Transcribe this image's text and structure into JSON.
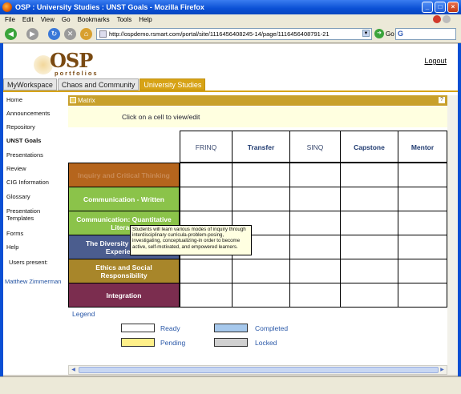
{
  "window": {
    "title": "OSP : University Studies : UNST Goals - Mozilla Firefox",
    "minimize": "_",
    "maximize": "□",
    "close": "×"
  },
  "menubar": [
    "File",
    "Edit",
    "View",
    "Go",
    "Bookmarks",
    "Tools",
    "Help"
  ],
  "navbar": {
    "back": "◀",
    "forward": "▶",
    "reload": "↻",
    "stop": "✕",
    "home": "⌂",
    "url": "http://ospdemo.rsmart.com/portal/site/1116456408245-14/page/1116456408791-21",
    "go_label": "Go",
    "search_value": "G"
  },
  "header": {
    "logo_text": "OSP",
    "logo_sub": "portfolios",
    "logout": "Logout"
  },
  "tabs": [
    {
      "label": "MyWorkspace",
      "active": false
    },
    {
      "label": "Chaos and Community",
      "active": false
    },
    {
      "label": "University Studies",
      "active": true
    }
  ],
  "sidebar": {
    "items": [
      {
        "label": "Home",
        "bold": false
      },
      {
        "label": "Announcements",
        "bold": false
      },
      {
        "label": "Repository",
        "bold": false
      },
      {
        "label": "UNST Goals",
        "bold": true
      },
      {
        "label": "Presentations",
        "bold": false
      },
      {
        "label": "Review",
        "bold": false
      },
      {
        "label": "CIG Information",
        "bold": false
      },
      {
        "label": "Glossary",
        "bold": false
      },
      {
        "label": "Presentation Templates",
        "bold": false
      },
      {
        "label": "Forms",
        "bold": false
      },
      {
        "label": "Help",
        "bold": false
      }
    ],
    "users_present_label": "Users present:",
    "user": "Matthew Zimmerman"
  },
  "matrix": {
    "title": "Matrix",
    "help": "?",
    "instruction": "Click on a cell to view/edit",
    "columns": [
      "FRINQ",
      "Transfer",
      "SINQ",
      "Capstone",
      "Mentor"
    ],
    "rows": [
      {
        "label": "Inquiry and Critical Thinking",
        "color": "#b5651d",
        "text_color": "#c98a55"
      },
      {
        "label": "Communication - Written",
        "color": "#8bc34a"
      },
      {
        "label": "Communication: Quantitative Literacy",
        "color": "#8bc34a"
      },
      {
        "label": "The Diversity of Human Experience",
        "color": "#4b5d8e"
      },
      {
        "label": "Ethics and Social Responsibility",
        "color": "#a8862a"
      },
      {
        "label": "Integration",
        "color": "#7b2d4f"
      }
    ],
    "tooltip": "Students will learn various modes of inquiry through interdisciplinary curricula-problem-posing, investigating, conceptualizing-in order to become active, self-motivated, and empowered learners."
  },
  "legend": {
    "title": "Legend",
    "items": [
      {
        "label": "Ready",
        "color": "#ffffff"
      },
      {
        "label": "Completed",
        "color": "#a6c8ec"
      },
      {
        "label": "Pending",
        "color": "#fff08a"
      },
      {
        "label": "Locked",
        "color": "#d0d0d0"
      }
    ]
  },
  "scroll": {
    "left": "◀",
    "right": "▶"
  },
  "status": {
    "text": ""
  }
}
